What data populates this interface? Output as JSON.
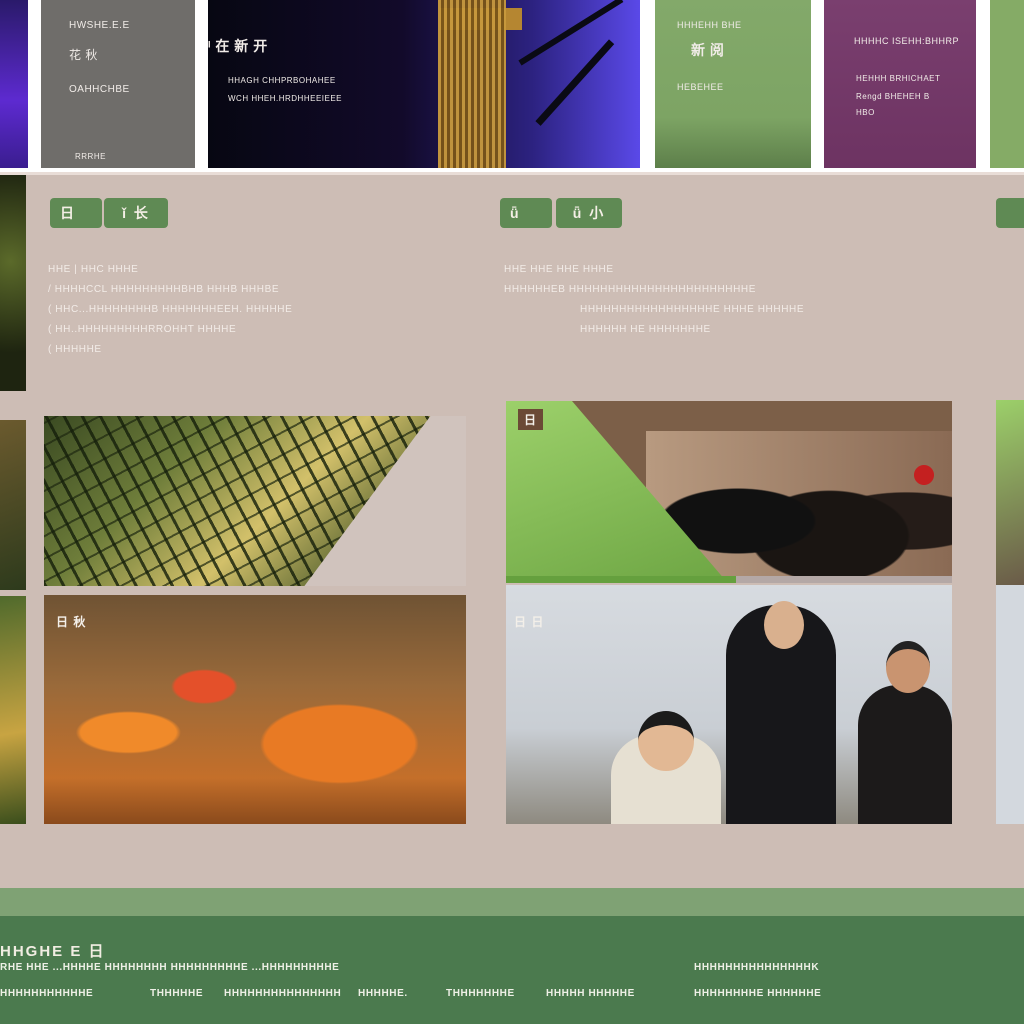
{
  "top_cards": [
    {
      "lines": [
        "HWSHE.E.E",
        "花 秋",
        "OAHHCHBE",
        "RRRHE"
      ]
    },
    {
      "lines": [
        "ᴵ 在 新 开",
        "HHAGH CHHPRBOHAHEE",
        "WCH HHEH.HRDHHEEIEEE"
      ]
    },
    {
      "lines": [
        "HHHEHH BHE",
        "新 阅",
        "HEBEHEE"
      ]
    },
    {
      "lines": [
        "HHHHC ISEHH:BHHRP",
        "HEHHH BRHICHAET",
        "Rengd BHEHEH B",
        "HBO"
      ]
    }
  ],
  "sections": [
    {
      "tag": "日",
      "badge": "ǐ 长",
      "desc_lines": [
        "HHE  |  HHC  HHHE",
        "/    HHHHCCL HHHHHHHHHBHB HHHB HHHBE",
        "(    HHC...HHHHHHHHB HHHHHHHEEH.  HHHHHE",
        "(    HH..HHHHHHHHHRROHHT  HHHHE",
        "(    HHHHHE"
      ]
    },
    {
      "tag": "ǖ",
      "badge": "ǖ 小",
      "desc_lines": [
        "HHE  HHE  HHE  HHHE",
        "HHHHHHEB   HHHHHHHHHHHHHHHHHHHHHHHE",
        "HHHHHHHHHHHHHHHHHE  HHHE  HHHHHE",
        "HHHHHH HE  HHHHHHHE"
      ]
    }
  ],
  "photos": {
    "gather_label": "日",
    "children_label": "日 秋",
    "portrait_label": "日 日"
  },
  "footer": {
    "title": "HHGHE  E  日",
    "links_row1": [
      "RHE  HHE  ...HHHHE  HHHHHHHH  HHHHHHHHHE  ...HHHHHHHHHE",
      "HHHHHHHHHHHHHHHK"
    ],
    "links_row2": [
      "HHHHHHHHHHHE",
      "THHHHHE",
      "HHHHHHHHHHHHHHH",
      "HHHHHE.",
      "THHHHHHHE",
      "HHHHH HHHHHE",
      "HHHHHHHHE  HHHHHHE"
    ]
  }
}
